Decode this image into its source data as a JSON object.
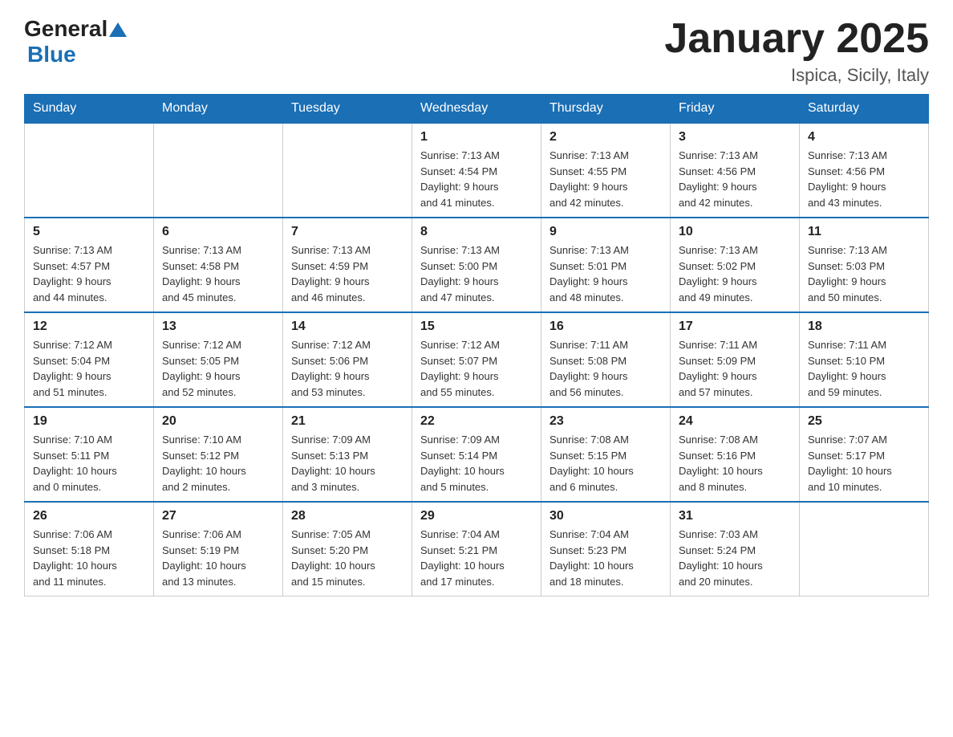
{
  "header": {
    "logo_general": "General",
    "logo_blue": "Blue",
    "month_title": "January 2025",
    "location": "Ispica, Sicily, Italy"
  },
  "columns": [
    "Sunday",
    "Monday",
    "Tuesday",
    "Wednesday",
    "Thursday",
    "Friday",
    "Saturday"
  ],
  "weeks": [
    [
      {
        "day": "",
        "info": ""
      },
      {
        "day": "",
        "info": ""
      },
      {
        "day": "",
        "info": ""
      },
      {
        "day": "1",
        "info": "Sunrise: 7:13 AM\nSunset: 4:54 PM\nDaylight: 9 hours\nand 41 minutes."
      },
      {
        "day": "2",
        "info": "Sunrise: 7:13 AM\nSunset: 4:55 PM\nDaylight: 9 hours\nand 42 minutes."
      },
      {
        "day": "3",
        "info": "Sunrise: 7:13 AM\nSunset: 4:56 PM\nDaylight: 9 hours\nand 42 minutes."
      },
      {
        "day": "4",
        "info": "Sunrise: 7:13 AM\nSunset: 4:56 PM\nDaylight: 9 hours\nand 43 minutes."
      }
    ],
    [
      {
        "day": "5",
        "info": "Sunrise: 7:13 AM\nSunset: 4:57 PM\nDaylight: 9 hours\nand 44 minutes."
      },
      {
        "day": "6",
        "info": "Sunrise: 7:13 AM\nSunset: 4:58 PM\nDaylight: 9 hours\nand 45 minutes."
      },
      {
        "day": "7",
        "info": "Sunrise: 7:13 AM\nSunset: 4:59 PM\nDaylight: 9 hours\nand 46 minutes."
      },
      {
        "day": "8",
        "info": "Sunrise: 7:13 AM\nSunset: 5:00 PM\nDaylight: 9 hours\nand 47 minutes."
      },
      {
        "day": "9",
        "info": "Sunrise: 7:13 AM\nSunset: 5:01 PM\nDaylight: 9 hours\nand 48 minutes."
      },
      {
        "day": "10",
        "info": "Sunrise: 7:13 AM\nSunset: 5:02 PM\nDaylight: 9 hours\nand 49 minutes."
      },
      {
        "day": "11",
        "info": "Sunrise: 7:13 AM\nSunset: 5:03 PM\nDaylight: 9 hours\nand 50 minutes."
      }
    ],
    [
      {
        "day": "12",
        "info": "Sunrise: 7:12 AM\nSunset: 5:04 PM\nDaylight: 9 hours\nand 51 minutes."
      },
      {
        "day": "13",
        "info": "Sunrise: 7:12 AM\nSunset: 5:05 PM\nDaylight: 9 hours\nand 52 minutes."
      },
      {
        "day": "14",
        "info": "Sunrise: 7:12 AM\nSunset: 5:06 PM\nDaylight: 9 hours\nand 53 minutes."
      },
      {
        "day": "15",
        "info": "Sunrise: 7:12 AM\nSunset: 5:07 PM\nDaylight: 9 hours\nand 55 minutes."
      },
      {
        "day": "16",
        "info": "Sunrise: 7:11 AM\nSunset: 5:08 PM\nDaylight: 9 hours\nand 56 minutes."
      },
      {
        "day": "17",
        "info": "Sunrise: 7:11 AM\nSunset: 5:09 PM\nDaylight: 9 hours\nand 57 minutes."
      },
      {
        "day": "18",
        "info": "Sunrise: 7:11 AM\nSunset: 5:10 PM\nDaylight: 9 hours\nand 59 minutes."
      }
    ],
    [
      {
        "day": "19",
        "info": "Sunrise: 7:10 AM\nSunset: 5:11 PM\nDaylight: 10 hours\nand 0 minutes."
      },
      {
        "day": "20",
        "info": "Sunrise: 7:10 AM\nSunset: 5:12 PM\nDaylight: 10 hours\nand 2 minutes."
      },
      {
        "day": "21",
        "info": "Sunrise: 7:09 AM\nSunset: 5:13 PM\nDaylight: 10 hours\nand 3 minutes."
      },
      {
        "day": "22",
        "info": "Sunrise: 7:09 AM\nSunset: 5:14 PM\nDaylight: 10 hours\nand 5 minutes."
      },
      {
        "day": "23",
        "info": "Sunrise: 7:08 AM\nSunset: 5:15 PM\nDaylight: 10 hours\nand 6 minutes."
      },
      {
        "day": "24",
        "info": "Sunrise: 7:08 AM\nSunset: 5:16 PM\nDaylight: 10 hours\nand 8 minutes."
      },
      {
        "day": "25",
        "info": "Sunrise: 7:07 AM\nSunset: 5:17 PM\nDaylight: 10 hours\nand 10 minutes."
      }
    ],
    [
      {
        "day": "26",
        "info": "Sunrise: 7:06 AM\nSunset: 5:18 PM\nDaylight: 10 hours\nand 11 minutes."
      },
      {
        "day": "27",
        "info": "Sunrise: 7:06 AM\nSunset: 5:19 PM\nDaylight: 10 hours\nand 13 minutes."
      },
      {
        "day": "28",
        "info": "Sunrise: 7:05 AM\nSunset: 5:20 PM\nDaylight: 10 hours\nand 15 minutes."
      },
      {
        "day": "29",
        "info": "Sunrise: 7:04 AM\nSunset: 5:21 PM\nDaylight: 10 hours\nand 17 minutes."
      },
      {
        "day": "30",
        "info": "Sunrise: 7:04 AM\nSunset: 5:23 PM\nDaylight: 10 hours\nand 18 minutes."
      },
      {
        "day": "31",
        "info": "Sunrise: 7:03 AM\nSunset: 5:24 PM\nDaylight: 10 hours\nand 20 minutes."
      },
      {
        "day": "",
        "info": ""
      }
    ]
  ]
}
